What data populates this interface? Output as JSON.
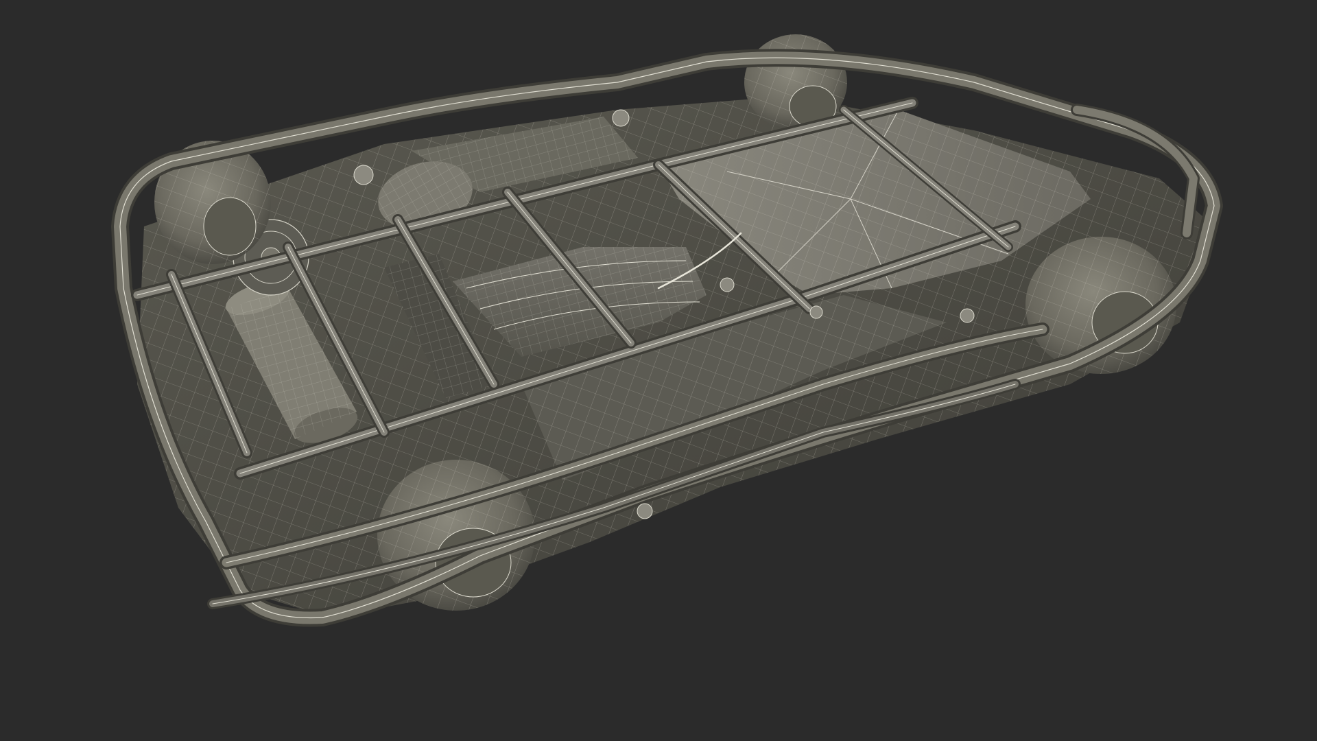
{
  "scene": {
    "background_color": "#2b2b2b",
    "model_fill_color": "#6e6c62",
    "model_shadow_color": "#3e3d37",
    "wireframe_color": "#e4e2d6"
  }
}
